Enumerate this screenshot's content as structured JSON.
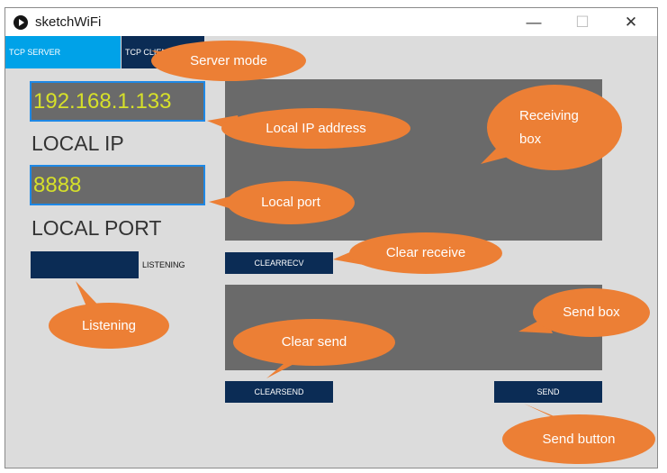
{
  "window": {
    "title": "sketchWiFi",
    "controls": {
      "minimize": "—",
      "maximize": "☐",
      "close": "✕"
    }
  },
  "tabs": [
    {
      "label": "TCP SERVER",
      "active": true
    },
    {
      "label": "TCP CLIENT",
      "active": false
    }
  ],
  "local": {
    "ip_value": "192.168.1.133",
    "ip_label": "LOCAL IP",
    "port_value": "8888",
    "port_label": "LOCAL PORT"
  },
  "listen": {
    "label": "LISTENING"
  },
  "buttons": {
    "clear_recv": "CLEARRECV",
    "clear_send": "CLEARSEND",
    "send": "SEND"
  },
  "callouts": {
    "server_mode": "Server mode",
    "local_ip": "Local IP address",
    "local_port": "Local port",
    "listening": "Listening",
    "receiving_box_1": "Receiving",
    "receiving_box_2": "box",
    "clear_receive": "Clear receive",
    "send_box": "Send box",
    "clear_send": "Clear send",
    "send_button": "Send button"
  },
  "colors": {
    "accent": "#1e88e5",
    "active_tab": "#00a2e8",
    "dark_button": "#0b2c55",
    "field_text": "#d6e02a",
    "callout": "#ec7f35"
  }
}
